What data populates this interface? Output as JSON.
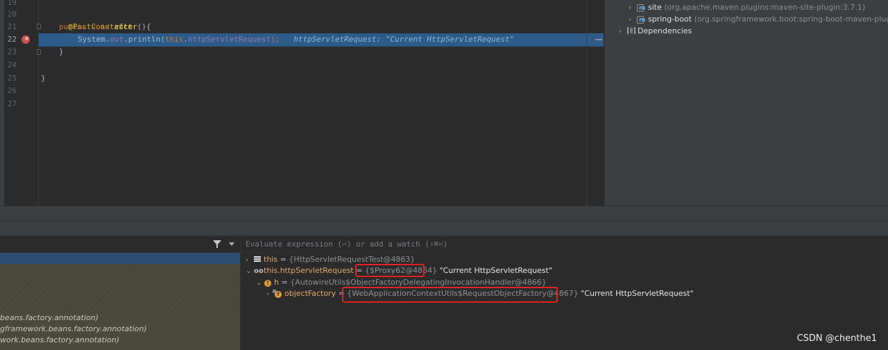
{
  "editor": {
    "line_numbers": [
      "19",
      "20",
      "21",
      "22",
      "23",
      "24",
      "25",
      "26",
      "27"
    ],
    "active_line": "22",
    "lines": {
      "l20_annotation": "@PostConstruct",
      "l21_public": "public",
      "l21_void": "void",
      "l21_method": "after",
      "l21_rest": "(){",
      "l22_system": "System.",
      "l22_out": "out",
      "l22_println": ".println(",
      "l22_this": "this",
      "l22_dot": ".",
      "l22_field": "httpServletRequest",
      "l22_end": ");",
      "l22_inlay": "httpServletRequest: \"Current HttpServletRequest\"",
      "l23_brace": "}",
      "l25_brace": "}"
    }
  },
  "maven": {
    "plugins": [
      {
        "name": "site",
        "id": "(org.apache.maven.plugins:maven-site-plugin:3.7.1)"
      },
      {
        "name": "spring-boot",
        "id": "(org.springframework.boot:spring-boot-maven-plugin:2"
      }
    ],
    "dependencies_label": "Dependencies"
  },
  "debugger": {
    "eval_placeholder": "Evaluate expression (⏎) or add a watch (⇧⌘⏎)",
    "frames": [
      "beans.factory.annotation)",
      "gframework.beans.factory.annotation)",
      "work.beans.factory.annotation)"
    ],
    "variables": [
      {
        "name": "this",
        "eq": " = ",
        "type": "{HttpServletRequestTest@4863}"
      },
      {
        "name": "this.httpServletRequest",
        "eq": " = ",
        "type": "{$Proxy62@4864}",
        "value": " \"Current HttpServletRequest\""
      },
      {
        "name": "h",
        "eq": " = ",
        "type": "{AutowireUtils$ObjectFactoryDelegatingInvocationHandler@4866}"
      },
      {
        "name": "objectFactory",
        "eq": " = ",
        "type": "{WebApplicationContextUtils$RequestObjectFactory@4867}",
        "value": " \"Current HttpServletRequest\""
      }
    ]
  },
  "watermark": "CSDN @chenthe1",
  "colors": {
    "editor_bg": "#2b2b2b",
    "execution_line": "#2d5b8a",
    "breakpoint": "#c75450",
    "highlight_box": "#e02323",
    "annotation": "#bbb529",
    "keyword": "#cc7832"
  }
}
